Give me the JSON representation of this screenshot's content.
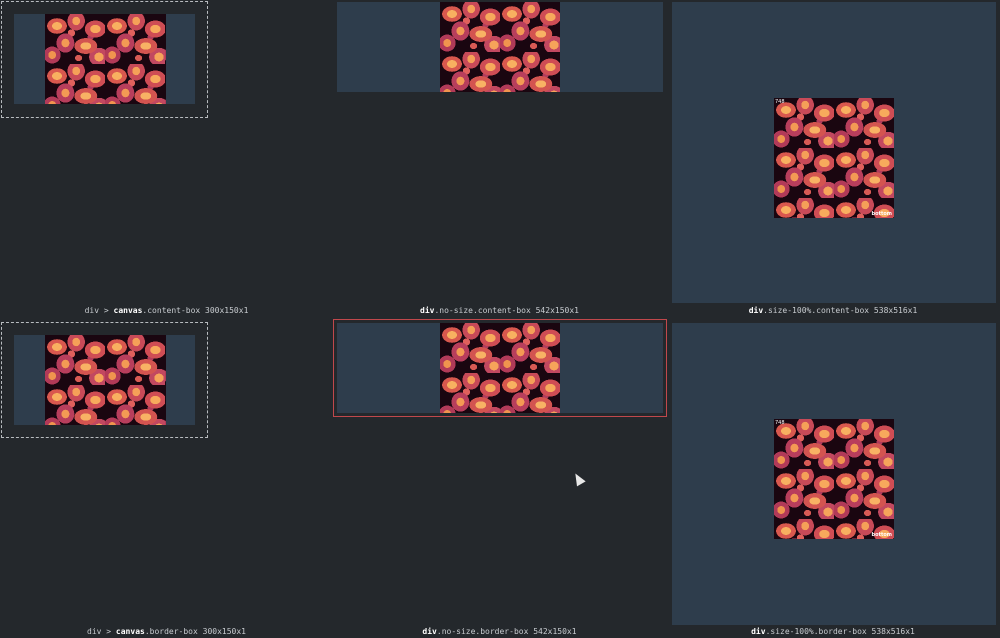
{
  "cells": [
    {
      "id": "top-left",
      "label": {
        "pre": "div > ",
        "strong": "canvas",
        "post": ".content-box 300x150x1"
      }
    },
    {
      "id": "top-mid",
      "label": {
        "pre": "",
        "strong": "div",
        "post": ".no-size.content-box 542x150x1"
      }
    },
    {
      "id": "top-right",
      "label": {
        "pre": "",
        "strong": "div",
        "post": ".size-100%.content-box 538x516x1"
      }
    },
    {
      "id": "bot-left",
      "label": {
        "pre": "div > ",
        "strong": "canvas",
        "post": ".border-box 300x150x1"
      }
    },
    {
      "id": "bot-mid",
      "label": {
        "pre": "",
        "strong": "div",
        "post": ".no-size.border-box 542x150x1"
      }
    },
    {
      "id": "bot-right",
      "label": {
        "pre": "",
        "strong": "div",
        "post": ".size-100%.border-box 538x516x1"
      }
    }
  ],
  "badges": {
    "top_left": "748",
    "bottom_right": "bottom"
  },
  "colors": {
    "background": "#24282c",
    "panel": "#2e3d4c",
    "highlight_border": "#c0484c",
    "selection_outline": "#b8bcc0"
  }
}
